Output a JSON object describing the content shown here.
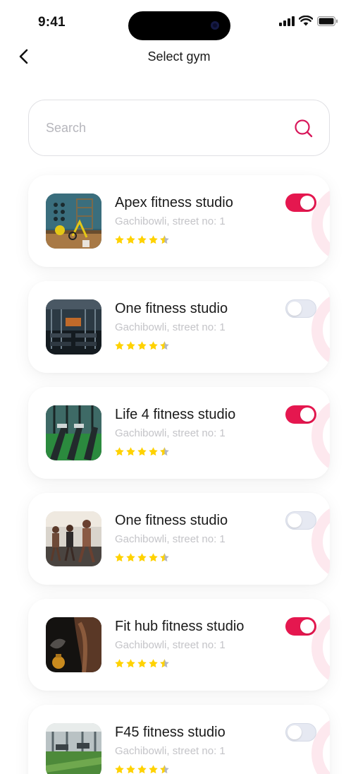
{
  "status_bar": {
    "time": "9:41"
  },
  "header": {
    "title": "Select gym",
    "back_icon": "chevron-left-icon"
  },
  "search": {
    "placeholder": "Search",
    "value": "",
    "icon": "search-icon"
  },
  "colors": {
    "accent": "#e5174f",
    "star": "#ffd200",
    "toggle_off": "#e6e9f2"
  },
  "gyms": [
    {
      "name": "Apex fitness studio",
      "address": "Gachibowli, street no: 1",
      "rating": 4.5,
      "selected": true
    },
    {
      "name": "One fitness studio",
      "address": "Gachibowli, street no: 1",
      "rating": 4.5,
      "selected": false
    },
    {
      "name": "Life 4 fitness studio",
      "address": "Gachibowli, street no: 1",
      "rating": 4.5,
      "selected": true
    },
    {
      "name": "One fitness studio",
      "address": "Gachibowli, street no: 1",
      "rating": 4.5,
      "selected": false
    },
    {
      "name": "Fit hub fitness studio",
      "address": "Gachibowli, street no: 1",
      "rating": 4.5,
      "selected": true
    },
    {
      "name": "F45 fitness studio",
      "address": "Gachibowli, street no: 1",
      "rating": 4.5,
      "selected": false
    }
  ]
}
